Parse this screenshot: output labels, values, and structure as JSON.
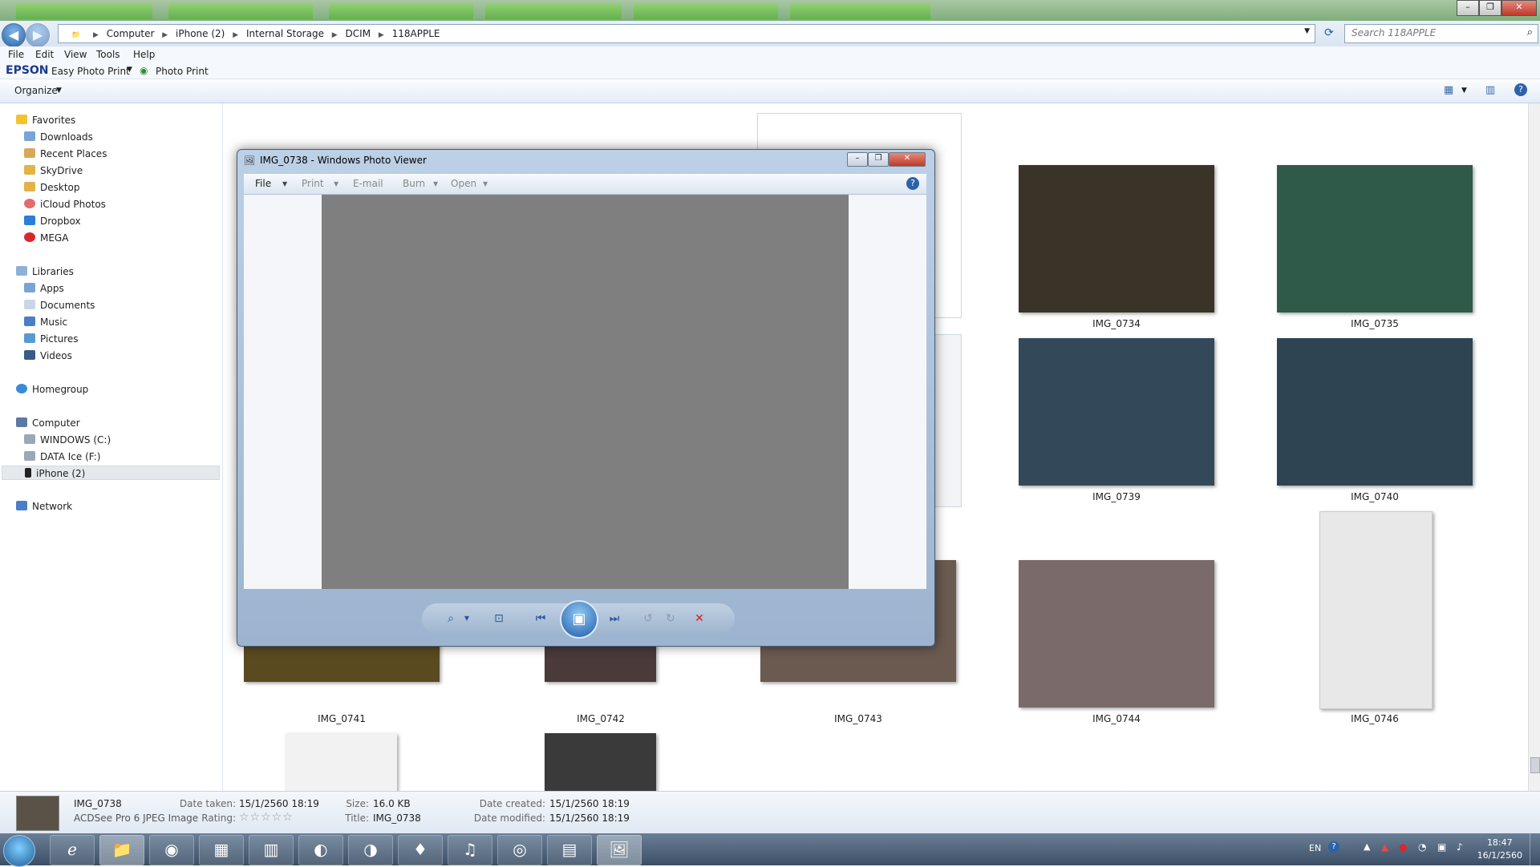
{
  "explorer": {
    "breadcrumbs": [
      "Computer",
      "iPhone (2)",
      "Internal Storage",
      "DCIM",
      "118APPLE"
    ],
    "search_placeholder": "Search 118APPLE",
    "menu": [
      "File",
      "Edit",
      "View",
      "Tools",
      "Help"
    ],
    "epson": {
      "brand": "EPSON",
      "easy_photo_print": "Easy Photo Print",
      "photo_print": "Photo Print"
    },
    "organize_label": "Organize"
  },
  "nav": {
    "favorites": {
      "label": "Favorites",
      "items": [
        "Downloads",
        "Recent Places",
        "SkyDrive",
        "Desktop",
        "iCloud Photos",
        "Dropbox",
        "MEGA"
      ]
    },
    "libraries": {
      "label": "Libraries",
      "items": [
        "Apps",
        "Documents",
        "Music",
        "Pictures",
        "Videos"
      ]
    },
    "homegroup": "Homegroup",
    "computer": {
      "label": "Computer",
      "items": [
        "WINDOWS (C:)",
        "DATA Ice (F:)",
        "iPhone (2)"
      ]
    },
    "network": "Network"
  },
  "thumbnails": [
    {
      "label": "IMG_0734",
      "color": "#3a3428"
    },
    {
      "label": "IMG_0735",
      "color": "#2f5a4a"
    },
    {
      "label": "IMG_0739",
      "color": "#33495a"
    },
    {
      "label": "IMG_0740",
      "color": "#2e4452"
    },
    {
      "label": "IMG_0741",
      "color": "#5a4a20"
    },
    {
      "label": "IMG_0742",
      "color": "#4a3a3a"
    },
    {
      "label": "IMG_0743",
      "color": "#6a5a50"
    },
    {
      "label": "IMG_0744",
      "color": "#7a6a6a"
    },
    {
      "label": "IMG_0746",
      "color": "#e8e8e8"
    }
  ],
  "details": {
    "filename": "IMG_0738",
    "filetype": "ACDSee Pro 6 JPEG Image",
    "date_taken_label": "Date taken:",
    "date_taken": "15/1/2560 18:19",
    "rating_label": "Rating:",
    "rating_stars": "☆☆☆☆☆",
    "size_label": "Size:",
    "size": "16.0 KB",
    "title_label": "Title:",
    "title": "IMG_0738",
    "date_created_label": "Date created:",
    "date_created": "15/1/2560 18:19",
    "date_modified_label": "Date modified:",
    "date_modified": "15/1/2560 18:19"
  },
  "viewer": {
    "title": "IMG_0738 - Windows Photo Viewer",
    "toolbar": [
      "File",
      "Print",
      "E-mail",
      "Burn",
      "Open"
    ]
  },
  "taskbar": {
    "language": "EN",
    "time": "18:47",
    "date": "16/1/2560"
  }
}
